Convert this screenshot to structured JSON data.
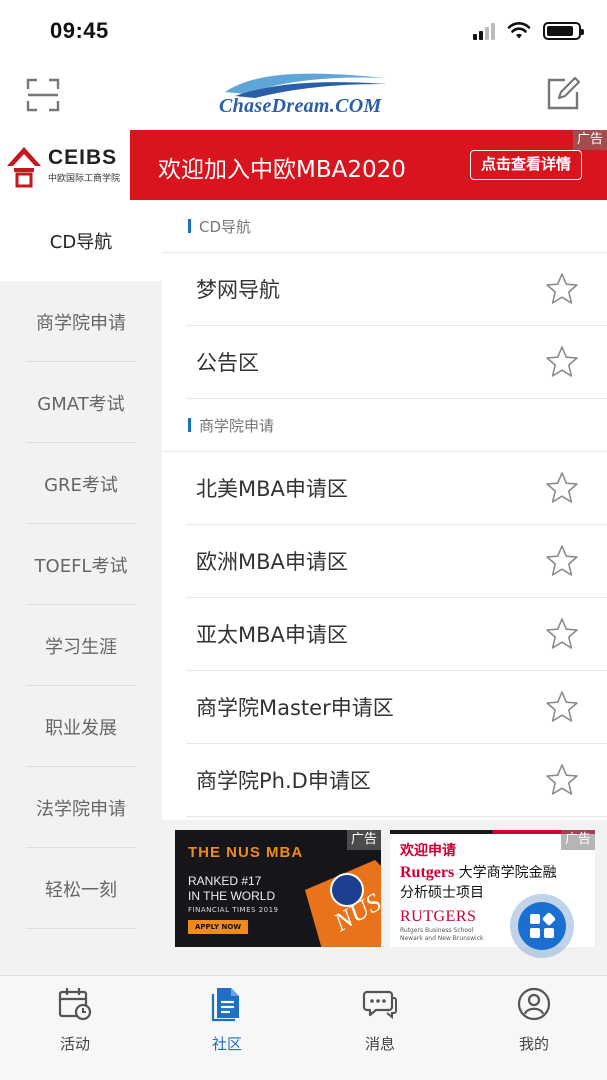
{
  "status_bar": {
    "time": "09:45"
  },
  "header": {
    "logo_text": "ChaseDream.COM"
  },
  "top_banner": {
    "brand": "CEIBS",
    "brand_sub": "中欧国际工商学院",
    "headline": "欢迎加入中欧MBA2020",
    "cta": "点击查看详情",
    "ad_label": "广告"
  },
  "sidebar": {
    "items": [
      {
        "label": "CD导航",
        "active": true
      },
      {
        "label": "商学院申请",
        "active": false
      },
      {
        "label": "GMAT考试",
        "active": false
      },
      {
        "label": "GRE考试",
        "active": false
      },
      {
        "label": "TOEFL考试",
        "active": false
      },
      {
        "label": "学习生涯",
        "active": false
      },
      {
        "label": "职业发展",
        "active": false
      },
      {
        "label": "法学院申请",
        "active": false
      },
      {
        "label": "轻松一刻",
        "active": false
      }
    ]
  },
  "sections": [
    {
      "title": "CD导航",
      "forums": [
        {
          "name": "梦网导航"
        },
        {
          "name": "公告区"
        }
      ]
    },
    {
      "title": "商学院申请",
      "forums": [
        {
          "name": "北美MBA申请区"
        },
        {
          "name": "欧洲MBA申请区"
        },
        {
          "name": "亚太MBA申请区"
        },
        {
          "name": "商学院Master申请区"
        },
        {
          "name": "商学院Ph.D申请区"
        }
      ]
    }
  ],
  "ads": {
    "nus": {
      "title": "THE NUS MBA",
      "ranked_line1": "RANKED #17",
      "ranked_line2": "IN THE WORLD",
      "source": "FINANCIAL TIMES 2019",
      "apply": "APPLY NOW",
      "ad_label": "广告"
    },
    "rutgers": {
      "welcome": "欢迎申请",
      "brand": "Rutgers",
      "line1_rest": " 大学商学院金融",
      "line2": "分析硕士项目",
      "logo": "RUTGERS",
      "school_line1": "Rutgers Business School",
      "school_line2": "Newark and New Brunswick",
      "ad_label": "广告"
    }
  },
  "tab_bar": {
    "tabs": [
      {
        "label": "活动",
        "icon": "calendar-clock-icon",
        "active": false
      },
      {
        "label": "社区",
        "icon": "document-icon",
        "active": true
      },
      {
        "label": "消息",
        "icon": "chat-bubbles-icon",
        "active": false
      },
      {
        "label": "我的",
        "icon": "user-icon",
        "active": false
      }
    ]
  },
  "colors": {
    "accent": "#1f6fc5",
    "banner_red": "#d8141e",
    "sidebar_bg": "#f2f2f2"
  }
}
